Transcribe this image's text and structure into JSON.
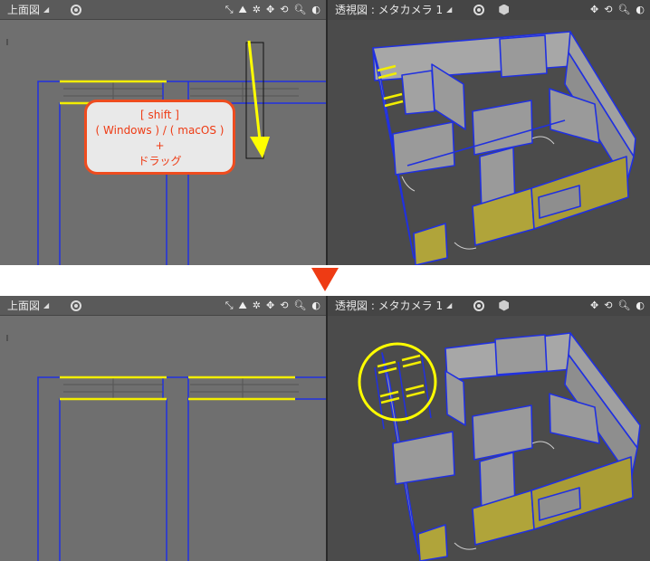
{
  "top_view": {
    "title": "上面図"
  },
  "persp_view": {
    "title": "透視図 : メタカメラ 1"
  },
  "toolbar": {
    "icons": [
      "fit-view-icon",
      "level-icon",
      "gear-icon",
      "move-icon",
      "rotate-icon",
      "zoom-icon",
      "shading-icon"
    ]
  },
  "callout": {
    "line1": "[ shift ]",
    "line2": "( Windows ) / ( macOS )",
    "line3": "+",
    "line4": "ドラッグ"
  },
  "colors": {
    "wire": "#2030e0",
    "selected": "#f2ee00",
    "wall_face": "#9a9a9a",
    "wall_top": "#b3b3b3",
    "yellow_face": "#b0a43a",
    "arrow": "#ffff00",
    "highlight_circle": "#ffff00",
    "step_arrow": "#ee3b14"
  }
}
